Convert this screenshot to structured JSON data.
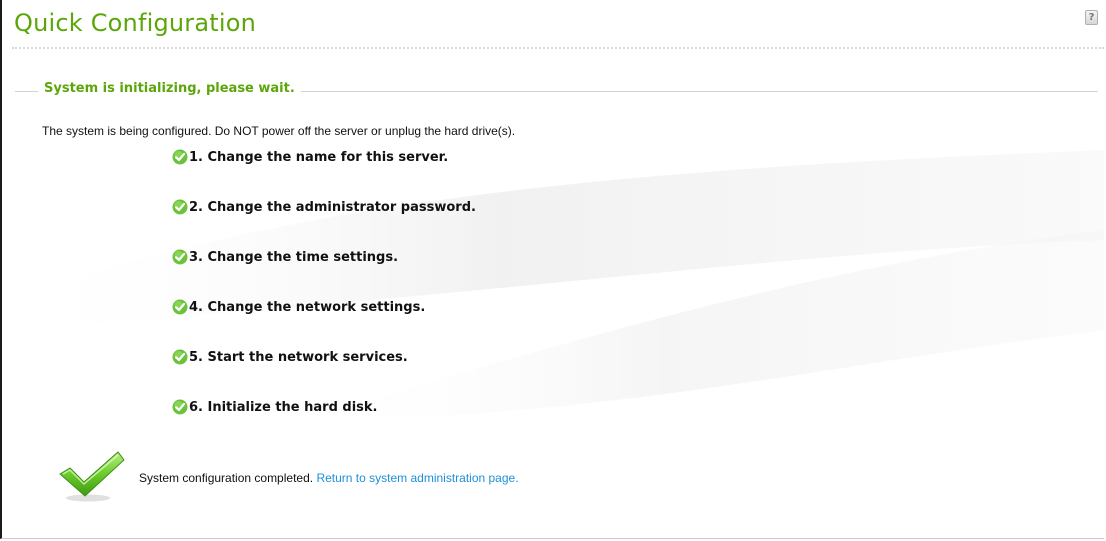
{
  "page": {
    "title": "Quick Configuration",
    "help_icon": "?"
  },
  "section": {
    "legend": "System is initializing, please wait.",
    "notice": "The system is being configured. Do NOT power off the server or unplug the hard drive(s)."
  },
  "steps": [
    {
      "label": "1. Change the name for this server.",
      "icon": "check-circle-icon",
      "status": "done"
    },
    {
      "label": "2. Change the administrator password.",
      "icon": "check-circle-icon",
      "status": "done"
    },
    {
      "label": "3. Change the time settings.",
      "icon": "check-circle-icon",
      "status": "done"
    },
    {
      "label": "4. Change the network settings.",
      "icon": "check-circle-icon",
      "status": "done"
    },
    {
      "label": "5. Start the network services.",
      "icon": "check-circle-icon",
      "status": "done"
    },
    {
      "label": "6. Initialize the hard disk.",
      "icon": "check-circle-icon",
      "status": "done"
    }
  ],
  "completion": {
    "icon": "large-checkmark-icon",
    "text": "System configuration completed.",
    "link_text": "Return to system administration page."
  },
  "colors": {
    "accent_green": "#5ca60a",
    "link_blue": "#1e90d8",
    "check_green": "#6cc23a"
  }
}
